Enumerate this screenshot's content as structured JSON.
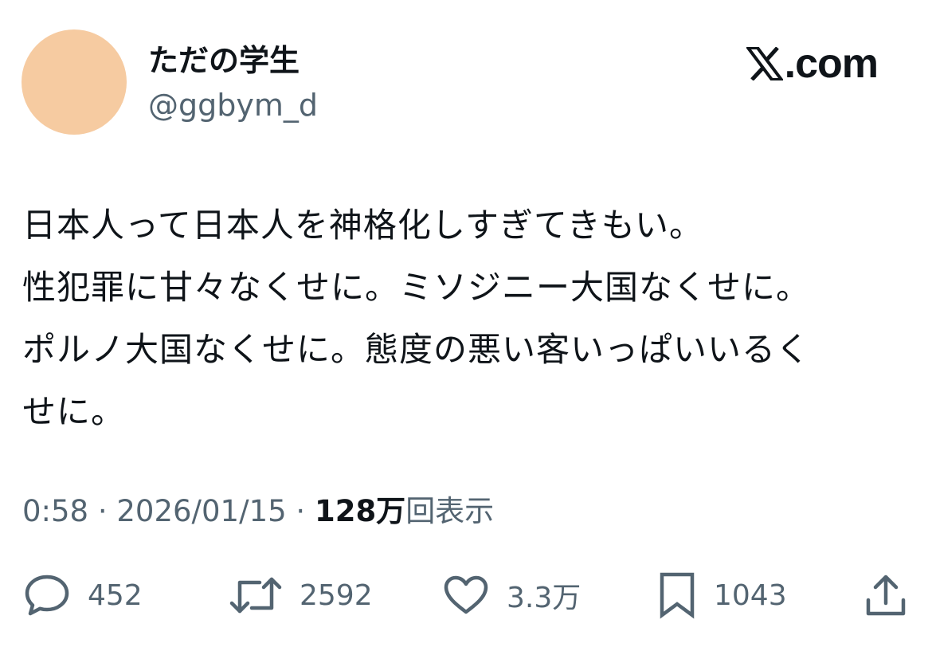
{
  "author": {
    "display_name": "ただの学生",
    "handle": "@ggbym_d",
    "avatar_color": "#f6cba1"
  },
  "brand": {
    "text": ".com",
    "logo_icon": "x-logo-icon"
  },
  "tweet": {
    "lines": [
      "日本人って日本人を神格化しすぎてきもい。",
      "性犯罪に甘々なくせに。ミソジニー大国なくせに。",
      "ポルノ大国なくせに。態度の悪い客いっぱいいるく",
      "せに。"
    ]
  },
  "meta": {
    "time": "0:58",
    "separator": " · ",
    "date": "2026/01/15",
    "views_count": "128万",
    "views_label": "回表示"
  },
  "actions": {
    "reply": {
      "icon": "reply-icon",
      "count": "452"
    },
    "repost": {
      "icon": "repost-icon",
      "count": "2592"
    },
    "like": {
      "icon": "heart-icon",
      "count": "3.3万"
    },
    "bookmark": {
      "icon": "bookmark-icon",
      "count": "1043"
    },
    "share": {
      "icon": "share-icon"
    }
  },
  "colors": {
    "text_primary": "#0f1419",
    "text_secondary": "#536471"
  }
}
